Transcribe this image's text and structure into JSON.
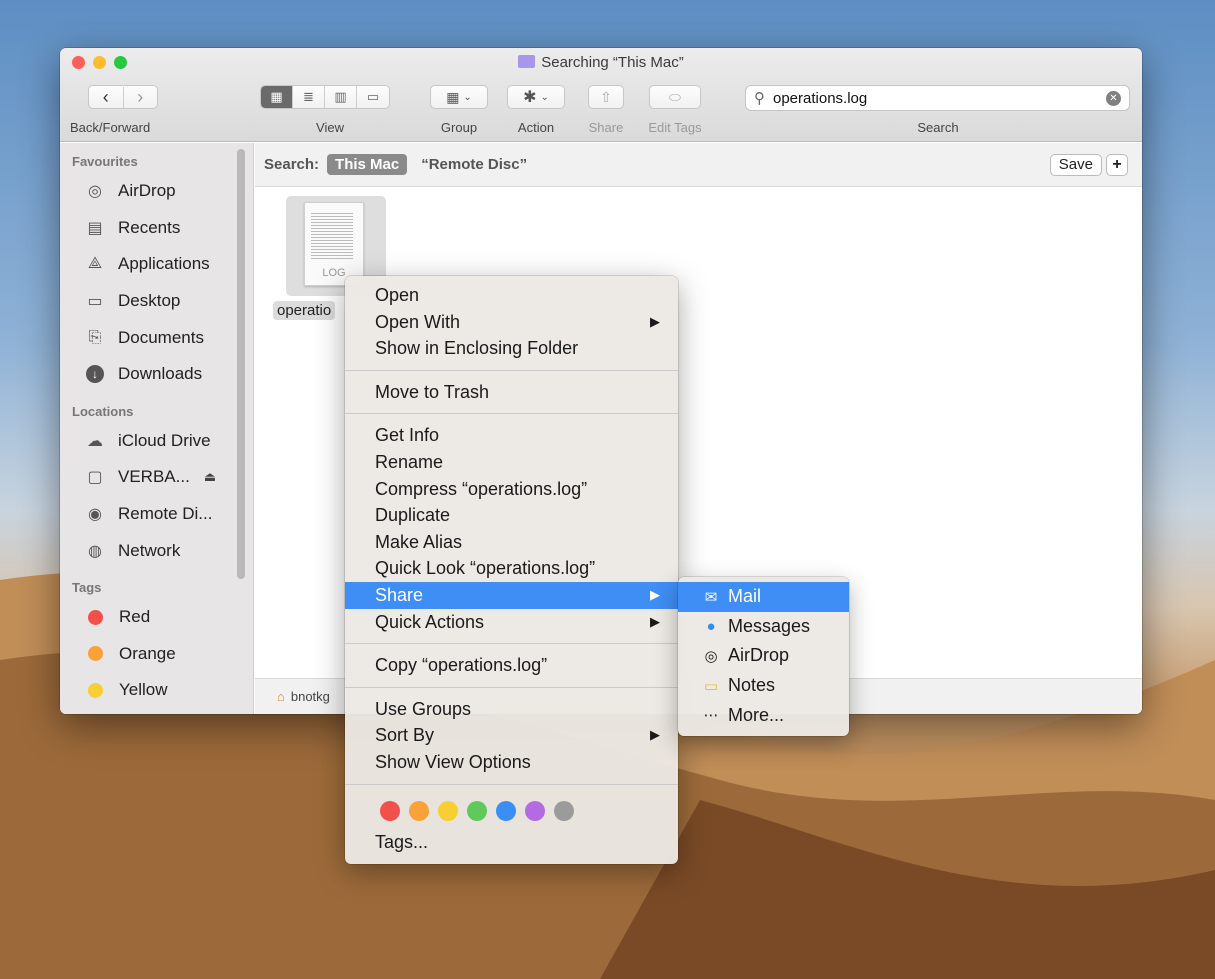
{
  "window": {
    "title": "Searching “This Mac”",
    "colors": {
      "close": "#fe5f57",
      "minimize": "#febc2e",
      "zoom": "#28c840"
    }
  },
  "toolbar": {
    "back_forward_label": "Back/Forward",
    "view_label": "View",
    "group_label": "Group",
    "action_label": "Action",
    "share_label": "Share",
    "edit_tags_label": "Edit Tags",
    "search_label": "Search",
    "search_value": "operations.log"
  },
  "sidebar": {
    "favourites_header": "Favourites",
    "favourites": [
      {
        "label": "AirDrop",
        "icon": "airdrop-icon"
      },
      {
        "label": "Recents",
        "icon": "recents-icon"
      },
      {
        "label": "Applications",
        "icon": "applications-icon"
      },
      {
        "label": "Desktop",
        "icon": "desktop-icon"
      },
      {
        "label": "Documents",
        "icon": "documents-icon"
      },
      {
        "label": "Downloads",
        "icon": "downloads-icon"
      }
    ],
    "locations_header": "Locations",
    "locations": [
      {
        "label": "iCloud Drive",
        "icon": "cloud-icon"
      },
      {
        "label": "VERBA...",
        "icon": "drive-icon"
      },
      {
        "label": "Remote Di...",
        "icon": "disc-icon"
      },
      {
        "label": "Network",
        "icon": "globe-icon"
      }
    ],
    "tags_header": "Tags",
    "tags": [
      {
        "label": "Red",
        "color": "#f2504b"
      },
      {
        "label": "Orange",
        "color": "#f9a23a"
      },
      {
        "label": "Yellow",
        "color": "#f7cf33"
      }
    ]
  },
  "search_scope": {
    "prefix": "Search:",
    "active": "This Mac",
    "other": "“Remote Disc”",
    "save_label": "Save",
    "add_label": "+"
  },
  "file": {
    "name": "operatio",
    "extension": "LOG"
  },
  "path_bar": {
    "text": "bnotkg"
  },
  "context_menu": {
    "open": "Open",
    "open_with": "Open With",
    "show_enclosing": "Show in Enclosing Folder",
    "move_to_trash": "Move to Trash",
    "get_info": "Get Info",
    "rename": "Rename",
    "compress": "Compress “operations.log”",
    "duplicate": "Duplicate",
    "make_alias": "Make Alias",
    "quick_look": "Quick Look “operations.log”",
    "share": "Share",
    "quick_actions": "Quick Actions",
    "copy": "Copy “operations.log”",
    "use_groups": "Use Groups",
    "sort_by": "Sort By",
    "show_view_options": "Show View Options",
    "tag_colors": [
      "#f2504b",
      "#f9a23a",
      "#f7cf33",
      "#5fc95c",
      "#3b8ef6",
      "#b36ae2",
      "#9b9b9b"
    ],
    "tags": "Tags...",
    "arrow": "▶"
  },
  "share_submenu": {
    "items": [
      "Mail",
      "Messages",
      "AirDrop",
      "Notes",
      "More..."
    ]
  }
}
